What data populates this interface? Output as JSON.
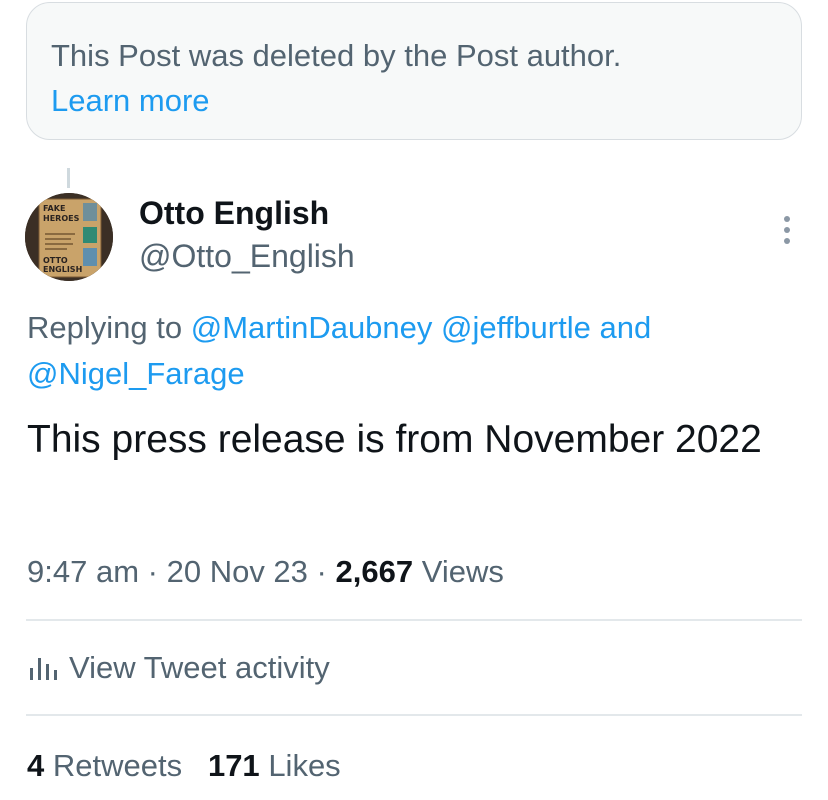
{
  "deleted_notice": {
    "text": "This Post was deleted by the Post author.",
    "link": "Learn more"
  },
  "author": {
    "name": "Otto English",
    "handle": "@Otto_English",
    "avatar_icon": "book-cover-avatar",
    "avatar_lettering": [
      "FAKE HEROES",
      "OTTO ENGLISH"
    ]
  },
  "more_icon": "more-vertical-icon",
  "reply": {
    "prefix": "Replying to",
    "mention_1": "@MartinDaubney",
    "mention_2": "@jeffburtle",
    "joiner": "and",
    "mention_3": "@Nigel_Farage"
  },
  "tweet": {
    "text": "This press release is from November 2022"
  },
  "meta": {
    "time": "9:47 am",
    "date": "20 Nov 23",
    "separator": "·",
    "views_count": "2,667",
    "views_label": "Views"
  },
  "activity": {
    "icon": "bar-chart-icon",
    "label": "View Tweet activity"
  },
  "stats": {
    "retweets_count": "4",
    "retweets_label": "Retweets",
    "likes_count": "171",
    "likes_label": "Likes"
  },
  "colors": {
    "link": "#1d9bf0",
    "secondary_text": "#536471",
    "primary_text": "#0f1419",
    "card_background": "#f7f9f9"
  }
}
